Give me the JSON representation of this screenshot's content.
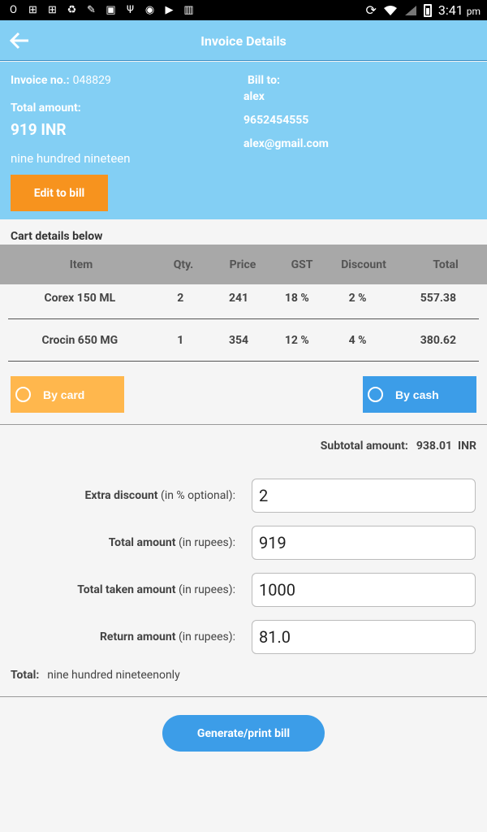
{
  "status_bar": {
    "time": "3:41",
    "ampm": "pm",
    "icons": [
      "o-icon",
      "grid-icon",
      "grid-icon",
      "recycle-icon",
      "paint-icon",
      "image-icon",
      "usb-icon",
      "vpn-icon",
      "play-icon",
      "barcode-icon"
    ]
  },
  "header": {
    "title": "Invoice Details"
  },
  "invoice": {
    "number_label": "Invoice no.:",
    "number": "048829",
    "total_label": "Total amount:",
    "total": "919 INR",
    "total_words": "nine hundred nineteen",
    "edit_button": "Edit to bill"
  },
  "bill_to": {
    "label": "Bill to:",
    "name": "alex",
    "phone": "9652454555",
    "email": "alex@gmail.com"
  },
  "cart": {
    "title": "Cart details below",
    "columns": [
      "Item",
      "Qty.",
      "Price",
      "GST",
      "Discount",
      "Total"
    ],
    "rows": [
      [
        "Corex 150 ML",
        "2",
        "241",
        "18 %",
        "2 %",
        "557.38"
      ],
      [
        "Crocin 650 MG",
        "1",
        "354",
        "12 %",
        "4 %",
        "380.62"
      ]
    ]
  },
  "payment": {
    "card_label": "By card",
    "cash_label": "By cash",
    "card_color": "#ffb74d",
    "cash_color": "#3c9de8"
  },
  "subtotal": {
    "label": "Subtotal amount:",
    "value": "938.01",
    "currency": "INR"
  },
  "fields": {
    "extra_discount": {
      "label": "Extra discount",
      "hint": "(in % optional):",
      "value": "2"
    },
    "total_amount": {
      "label": "Total amount",
      "hint": "(in rupees):",
      "value": "919"
    },
    "taken_amount": {
      "label": "Total taken amount",
      "hint": "(in rupees):",
      "value": "1000"
    },
    "return_amount": {
      "label": "Return amount",
      "hint": "(in rupees):",
      "value": "81.0"
    }
  },
  "total_words_row": {
    "label": "Total:",
    "value": "nine hundred nineteenonly"
  },
  "generate_button": "Generate/print bill",
  "colors": {
    "header_bg": "#83cff4",
    "accent_orange": "#f7931e",
    "accent_blue": "#3c9de8"
  }
}
